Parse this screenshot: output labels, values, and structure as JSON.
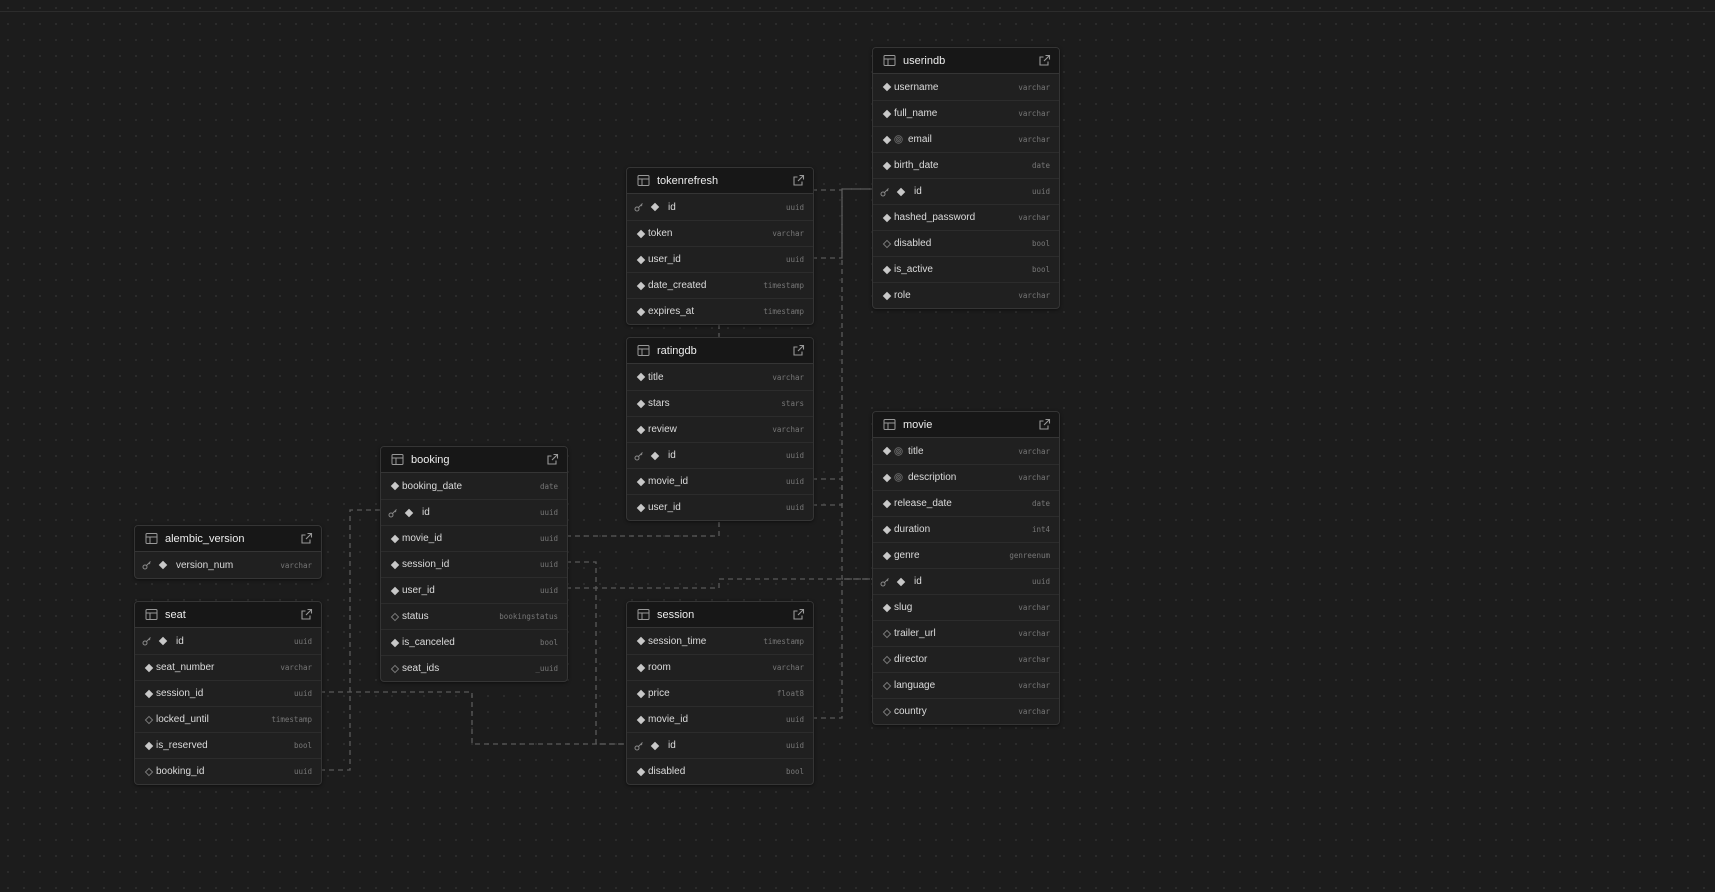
{
  "colors": {
    "background": "#1c1c1c",
    "card": "#202020",
    "card_header": "#171717",
    "border": "#353535",
    "edge": "#5a5a5a"
  },
  "icons": {
    "table": "table-grid-icon",
    "open": "external-link-icon",
    "primary_key": "key-icon",
    "not_null": "filled-diamond-icon",
    "nullable": "hollow-diamond-icon",
    "unique": "fingerprint-icon"
  },
  "tables": [
    {
      "name": "userindb",
      "columns": [
        {
          "name": "username",
          "type": "varchar",
          "nullable": false
        },
        {
          "name": "full_name",
          "type": "varchar",
          "nullable": false
        },
        {
          "name": "email",
          "type": "varchar",
          "nullable": false,
          "unique": true
        },
        {
          "name": "birth_date",
          "type": "date",
          "nullable": false
        },
        {
          "name": "id",
          "type": "uuid",
          "nullable": false,
          "pk": true
        },
        {
          "name": "hashed_password",
          "type": "varchar",
          "nullable": false
        },
        {
          "name": "disabled",
          "type": "bool",
          "nullable": true
        },
        {
          "name": "is_active",
          "type": "bool",
          "nullable": false
        },
        {
          "name": "role",
          "type": "varchar",
          "nullable": false
        }
      ]
    },
    {
      "name": "tokenrefresh",
      "columns": [
        {
          "name": "id",
          "type": "uuid",
          "nullable": false,
          "pk": true
        },
        {
          "name": "token",
          "type": "varchar",
          "nullable": false
        },
        {
          "name": "user_id",
          "type": "uuid",
          "nullable": false
        },
        {
          "name": "date_created",
          "type": "timestamp",
          "nullable": false
        },
        {
          "name": "expires_at",
          "type": "timestamp",
          "nullable": false
        }
      ]
    },
    {
      "name": "ratingdb",
      "columns": [
        {
          "name": "title",
          "type": "varchar",
          "nullable": false
        },
        {
          "name": "stars",
          "type": "stars",
          "nullable": false
        },
        {
          "name": "review",
          "type": "varchar",
          "nullable": false
        },
        {
          "name": "id",
          "type": "uuid",
          "nullable": false,
          "pk": true
        },
        {
          "name": "movie_id",
          "type": "uuid",
          "nullable": false
        },
        {
          "name": "user_id",
          "type": "uuid",
          "nullable": false
        }
      ]
    },
    {
      "name": "movie",
      "columns": [
        {
          "name": "title",
          "type": "varchar",
          "nullable": false,
          "unique": true
        },
        {
          "name": "description",
          "type": "varchar",
          "nullable": false,
          "unique": true
        },
        {
          "name": "release_date",
          "type": "date",
          "nullable": false
        },
        {
          "name": "duration",
          "type": "int4",
          "nullable": false
        },
        {
          "name": "genre",
          "type": "genreenum",
          "nullable": false
        },
        {
          "name": "id",
          "type": "uuid",
          "nullable": false,
          "pk": true
        },
        {
          "name": "slug",
          "type": "varchar",
          "nullable": false
        },
        {
          "name": "trailer_url",
          "type": "varchar",
          "nullable": true
        },
        {
          "name": "director",
          "type": "varchar",
          "nullable": true
        },
        {
          "name": "language",
          "type": "varchar",
          "nullable": true
        },
        {
          "name": "country",
          "type": "varchar",
          "nullable": true
        }
      ]
    },
    {
      "name": "booking",
      "columns": [
        {
          "name": "booking_date",
          "type": "date",
          "nullable": false
        },
        {
          "name": "id",
          "type": "uuid",
          "nullable": false,
          "pk": true
        },
        {
          "name": "movie_id",
          "type": "uuid",
          "nullable": false
        },
        {
          "name": "session_id",
          "type": "uuid",
          "nullable": false
        },
        {
          "name": "user_id",
          "type": "uuid",
          "nullable": false
        },
        {
          "name": "status",
          "type": "bookingstatus",
          "nullable": true
        },
        {
          "name": "is_canceled",
          "type": "bool",
          "nullable": false
        },
        {
          "name": "seat_ids",
          "type": "_uuid",
          "nullable": true
        }
      ]
    },
    {
      "name": "alembic_version",
      "columns": [
        {
          "name": "version_num",
          "type": "varchar",
          "nullable": false,
          "pk": true
        }
      ]
    },
    {
      "name": "seat",
      "columns": [
        {
          "name": "id",
          "type": "uuid",
          "nullable": false,
          "pk": true
        },
        {
          "name": "seat_number",
          "type": "varchar",
          "nullable": false
        },
        {
          "name": "session_id",
          "type": "uuid",
          "nullable": false
        },
        {
          "name": "locked_until",
          "type": "timestamp",
          "nullable": true
        },
        {
          "name": "is_reserved",
          "type": "bool",
          "nullable": false
        },
        {
          "name": "booking_id",
          "type": "uuid",
          "nullable": true
        }
      ]
    },
    {
      "name": "session",
      "columns": [
        {
          "name": "session_time",
          "type": "timestamp",
          "nullable": false
        },
        {
          "name": "room",
          "type": "varchar",
          "nullable": false
        },
        {
          "name": "price",
          "type": "float8",
          "nullable": false
        },
        {
          "name": "movie_id",
          "type": "uuid",
          "nullable": false
        },
        {
          "name": "id",
          "type": "uuid",
          "nullable": false,
          "pk": true
        },
        {
          "name": "disabled",
          "type": "bool",
          "nullable": false
        }
      ]
    }
  ]
}
